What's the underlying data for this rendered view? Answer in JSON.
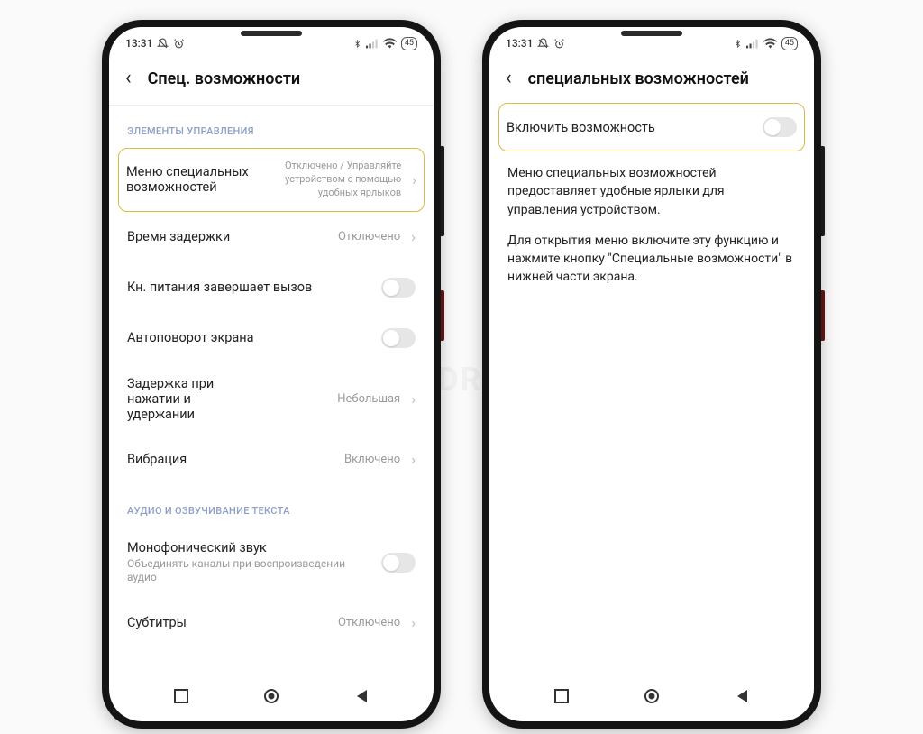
{
  "statusbar": {
    "time": "13:31",
    "battery": "45"
  },
  "watermark": "SIBDROID",
  "left": {
    "title": "Спец. возможности",
    "section1": "ЭЛЕМЕНТЫ УПРАВЛЕНИЯ",
    "section2": "АУДИО И ОЗВУЧИВАНИЕ ТЕКСТА",
    "row_menu_label": "Меню специальных возможностей",
    "row_menu_value": "Отключено / Управляйте устройством с помощью удобных ярлыков",
    "row_delay_label": "Время задержки",
    "row_delay_value": "Отключено",
    "row_power_label": "Кн. питания завершает вызов",
    "row_rotate_label": "Автоповорот экрана",
    "row_hold_label": "Задержка при нажатии и удержании",
    "row_hold_value": "Небольшая",
    "row_vibration_label": "Вибрация",
    "row_vibration_value": "Включено",
    "row_mono_label": "Монофонический звук",
    "row_mono_sub": "Объединять каналы при воспроизведении аудио",
    "row_subs_label": "Субтитры",
    "row_subs_value": "Отключено"
  },
  "right": {
    "title": "специальных возможностей",
    "enable_label": "Включить возможность",
    "desc1": "Меню специальных возможностей предоставляет удобные ярлыки для управления устройством.",
    "desc2": "Для открытия меню включите эту функцию и нажмите кнопку \"Специальные возможности\" в нижней части экрана."
  }
}
